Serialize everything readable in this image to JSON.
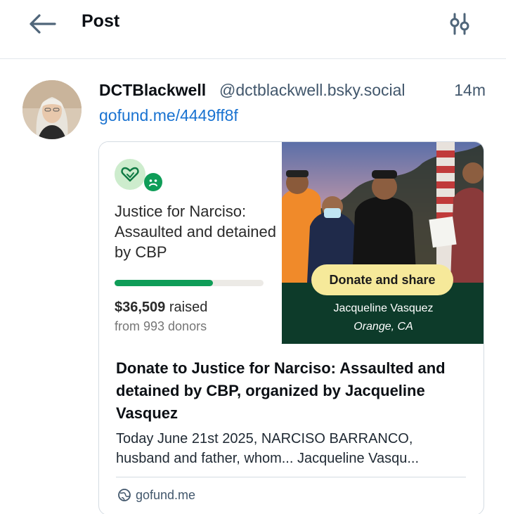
{
  "header": {
    "title": "Post",
    "back_icon": "arrow-left-icon",
    "filter_icon": "sliders-icon"
  },
  "post": {
    "author": {
      "display_name": "DCTBlackwell",
      "handle": "@dctblackwell.bsky.social"
    },
    "timestamp": "14m",
    "link_text": "gofund.me/4449ff8f",
    "embed": {
      "campaign_title": "Justice for Narciso: Assaulted and detained by CBP",
      "progress_fraction": 0.66,
      "raised_amount": "$36,509",
      "raised_suffix": " raised",
      "donors_text": "from 993 donors",
      "donate_button": "Donate and share",
      "organizer": "Jacqueline Vasquez",
      "location": "Orange, CA",
      "title": "Donate to Justice for Narciso: Assaulted and detained by CBP, organized by Jacqueline Vasquez",
      "description_line1": "Today June 21st 2025, NARCISO BARRANCO,",
      "description_line2": "husband and father, whom... Jacqueline Vasqu...",
      "domain": "gofund.me"
    }
  },
  "colors": {
    "brand_green": "#0f9d58",
    "link_blue": "#1a73d1",
    "muted_text": "#42576c",
    "donate_yellow": "#f6e99a",
    "band_green": "#0d3b2a"
  }
}
